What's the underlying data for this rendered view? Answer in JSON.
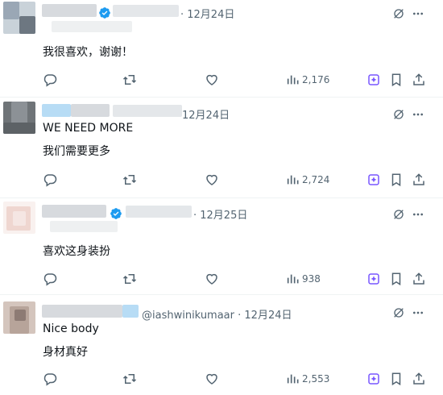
{
  "tweets": [
    {
      "display_name": "",
      "handle": "",
      "date": "12月24日",
      "verified": true,
      "lines": [
        "我很喜欢，谢谢！"
      ],
      "views": "2,176",
      "avatar_colors": [
        "#9aa7b5",
        "#6d7781",
        "#c9d2d9"
      ]
    },
    {
      "display_name": "",
      "handle": "",
      "date": "12月24日",
      "verified": false,
      "lines": [
        "WE NEED MORE",
        "我们需要更多"
      ],
      "views": "2,724",
      "avatar_colors": [
        "#6f7478",
        "#8c9196",
        "#5d6266"
      ]
    },
    {
      "display_name": "",
      "handle": "",
      "date": "12月25日",
      "verified": true,
      "lines": [
        "喜欢这身装扮"
      ],
      "views": "938",
      "avatar_colors": [
        "#f5e6e3",
        "#efd6d0",
        "#f9f1ef"
      ]
    },
    {
      "display_name": "",
      "handle": "@iashwinikumaar",
      "date": "12月24日",
      "verified": false,
      "lines": [
        "Nice body",
        "身材真好"
      ],
      "views": "2,553",
      "avatar_colors": [
        "#b7a49a",
        "#8d7b74",
        "#d4c5bd"
      ]
    }
  ],
  "icons": {
    "reply": "reply-icon",
    "retweet": "retweet-icon",
    "like": "like-icon",
    "views": "views-icon",
    "grok": "grok-icon",
    "bookmark": "bookmark-icon",
    "share": "share-icon",
    "mute": "grok-slash-icon",
    "more": "more-icon"
  },
  "colors": {
    "text": "#0f1419",
    "muted": "#536471",
    "verified": "#1d9bf0",
    "grok_accent": "#7856ff"
  }
}
